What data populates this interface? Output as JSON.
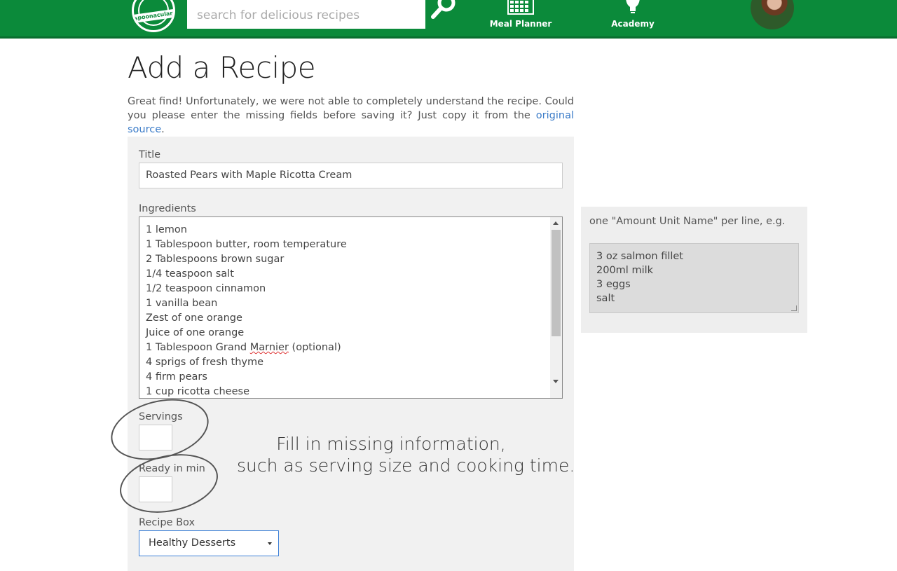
{
  "header": {
    "logo_text": "spoonacular",
    "search": {
      "placeholder": "search for delicious recipes",
      "value": ""
    },
    "nav": [
      {
        "label": "Meal Planner",
        "icon": "calendar-icon"
      },
      {
        "label": "Academy",
        "icon": "lightbulb-icon"
      }
    ],
    "brand_color": "#0b8a3a"
  },
  "page": {
    "title": "Add a Recipe",
    "intro_text": "Great find! Unfortunately, we were not able to completely understand the recipe. Could you please enter the missing fields before saving it? Just copy it from the ",
    "intro_link": "original source",
    "intro_end": "."
  },
  "form": {
    "title_label": "Title",
    "title_value": "Roasted Pears with Maple Ricotta Cream",
    "ingredients_label": "Ingredients",
    "ingredients": [
      "1 lemon",
      "1 Tablespoon butter, room temperature",
      "2 Tablespoons brown sugar",
      "1/4 teaspoon salt",
      "1/2 teaspoon cinnamon",
      "1 vanilla bean",
      "Zest of one orange",
      "Juice of one orange",
      {
        "before": "1 Tablespoon Grand ",
        "misspelled": "Marnier",
        "after": " (optional)"
      },
      "4 sprigs of fresh thyme",
      "4 firm pears",
      "1 cup ricotta cheese"
    ],
    "servings_label": "Servings",
    "servings_value": "",
    "ready_label": "Ready in min",
    "ready_value": "",
    "recipe_box_label": "Recipe Box",
    "recipe_box_value": "Healthy Desserts"
  },
  "annotation": {
    "line1": "Fill in missing information,",
    "line2": "such as serving size and cooking time."
  },
  "help": {
    "text": "one \"Amount Unit Name\" per line, e.g.",
    "examples": [
      "3 oz salmon fillet",
      "200ml milk",
      "3 eggs",
      "salt"
    ]
  }
}
